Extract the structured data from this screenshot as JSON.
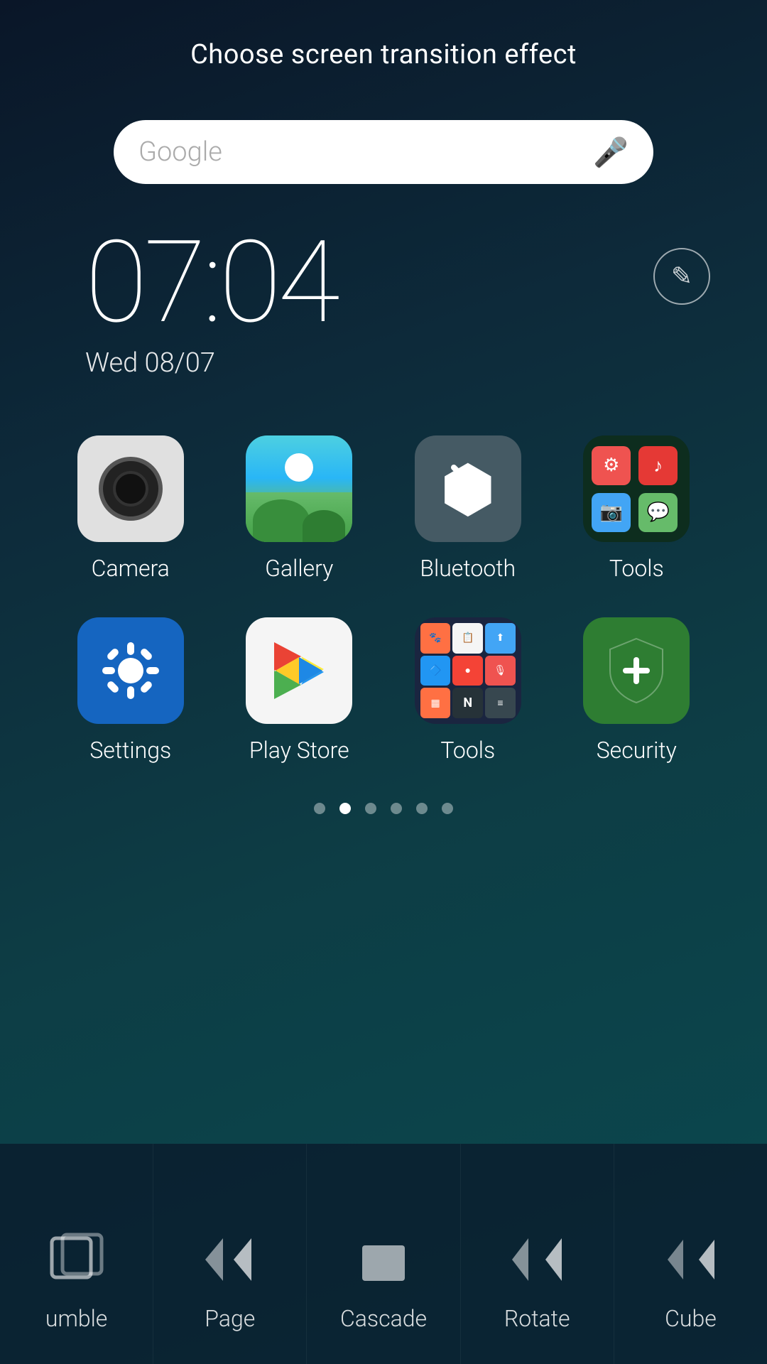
{
  "header": {
    "title": "Choose screen transition effect"
  },
  "search": {
    "placeholder": "Google",
    "mic_label": "mic"
  },
  "clock": {
    "time": "07:04",
    "day": "Wed 08/07"
  },
  "edit_button_label": "✏",
  "apps_row1": [
    {
      "id": "camera",
      "label": "Camera",
      "icon_type": "camera"
    },
    {
      "id": "gallery",
      "label": "Gallery",
      "icon_type": "gallery"
    },
    {
      "id": "bluetooth",
      "label": "Bluetooth",
      "icon_type": "bluetooth"
    },
    {
      "id": "tools",
      "label": "Tools",
      "icon_type": "tools_folder"
    }
  ],
  "apps_row2": [
    {
      "id": "settings",
      "label": "Settings",
      "icon_type": "settings"
    },
    {
      "id": "playstore",
      "label": "Play Store",
      "icon_type": "playstore"
    },
    {
      "id": "tools2",
      "label": "Tools",
      "icon_type": "tools2"
    },
    {
      "id": "security",
      "label": "Security",
      "icon_type": "security"
    }
  ],
  "page_dots": [
    0,
    1,
    2,
    3,
    4,
    5
  ],
  "active_dot": 1,
  "transitions": [
    {
      "id": "tumble",
      "label": "umble",
      "icon": "tumble"
    },
    {
      "id": "page",
      "label": "Page",
      "icon": "page"
    },
    {
      "id": "cascade",
      "label": "Cascade",
      "icon": "cascade"
    },
    {
      "id": "rotate",
      "label": "Rotate",
      "icon": "rotate"
    },
    {
      "id": "cube",
      "label": "Cube",
      "icon": "cube"
    }
  ]
}
